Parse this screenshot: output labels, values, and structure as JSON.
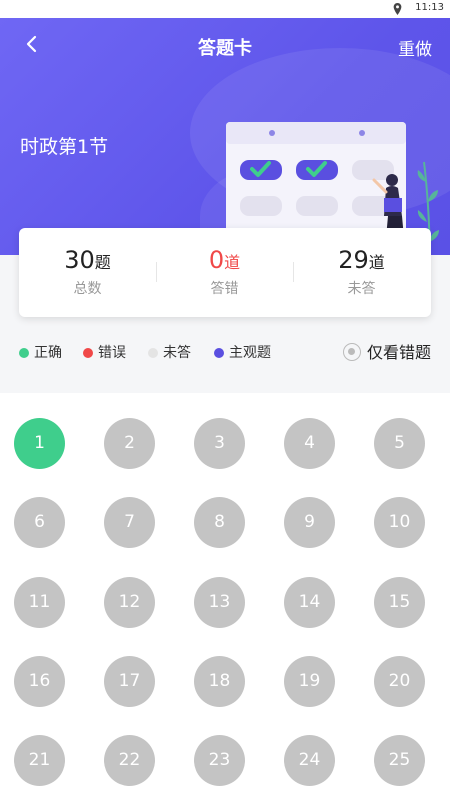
{
  "status_bar": {
    "time": "11:13"
  },
  "header": {
    "title": "答题卡",
    "redo_label": "重做"
  },
  "section_title": "时政第1节",
  "stats": [
    {
      "value": "30",
      "unit": "题",
      "label": "总数"
    },
    {
      "value": "0",
      "unit": "道",
      "label": "答错"
    },
    {
      "value": "29",
      "unit": "道",
      "label": "未答"
    }
  ],
  "legend": [
    {
      "label": "正确",
      "color": "#3fce8c"
    },
    {
      "label": "错误",
      "color": "#f04848"
    },
    {
      "label": "未答",
      "color": "#e4e4e4"
    },
    {
      "label": "主观题",
      "color": "#5a4fe0"
    }
  ],
  "filter_wrong_only": {
    "label": "仅看错题",
    "checked": false
  },
  "colors": {
    "header_bg": "#6c63f2",
    "correct": "#3fce8c",
    "wrong": "#f04848",
    "unanswered": "#c4c4c4"
  },
  "questions": [
    {
      "number": "1",
      "status": "correct"
    },
    {
      "number": "2",
      "status": "unanswered"
    },
    {
      "number": "3",
      "status": "unanswered"
    },
    {
      "number": "4",
      "status": "unanswered"
    },
    {
      "number": "5",
      "status": "unanswered"
    },
    {
      "number": "6",
      "status": "unanswered"
    },
    {
      "number": "7",
      "status": "unanswered"
    },
    {
      "number": "8",
      "status": "unanswered"
    },
    {
      "number": "9",
      "status": "unanswered"
    },
    {
      "number": "10",
      "status": "unanswered"
    },
    {
      "number": "11",
      "status": "unanswered"
    },
    {
      "number": "12",
      "status": "unanswered"
    },
    {
      "number": "13",
      "status": "unanswered"
    },
    {
      "number": "14",
      "status": "unanswered"
    },
    {
      "number": "15",
      "status": "unanswered"
    },
    {
      "number": "16",
      "status": "unanswered"
    },
    {
      "number": "17",
      "status": "unanswered"
    },
    {
      "number": "18",
      "status": "unanswered"
    },
    {
      "number": "19",
      "status": "unanswered"
    },
    {
      "number": "20",
      "status": "unanswered"
    },
    {
      "number": "21",
      "status": "unanswered"
    },
    {
      "number": "22",
      "status": "unanswered"
    },
    {
      "number": "23",
      "status": "unanswered"
    },
    {
      "number": "24",
      "status": "unanswered"
    },
    {
      "number": "25",
      "status": "unanswered"
    }
  ]
}
